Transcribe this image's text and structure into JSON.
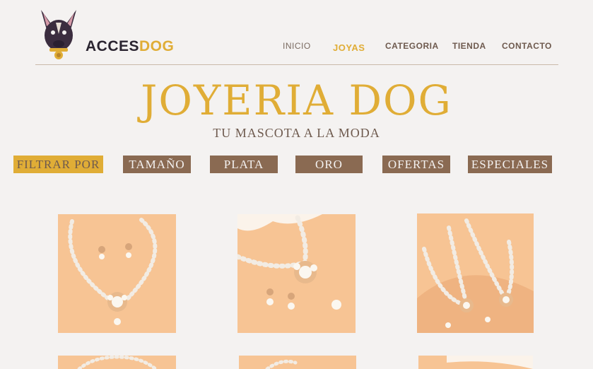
{
  "brand": {
    "part1": "ACCES",
    "part2": "DOG"
  },
  "nav": {
    "inicio": "INICIO",
    "joyas": "JOYAS",
    "categoria": "CATEGORIA",
    "tienda": "TIENDA",
    "contacto": "CONTACTO"
  },
  "hero": {
    "title": "JOYERIA DOG",
    "subtitle": "TU MASCOTA A LA MODA"
  },
  "filters": {
    "label": "FILTRAR POR",
    "tamano": "TAMAÑO",
    "plata": "PLATA",
    "oro": "ORO",
    "ofertas": "OFERTAS",
    "especiales": "ESPECIALES"
  },
  "colors": {
    "accent": "#e0ad36",
    "brown": "#8a6a52",
    "background": "#f4f2f1",
    "product_bg": "#f7c494"
  }
}
